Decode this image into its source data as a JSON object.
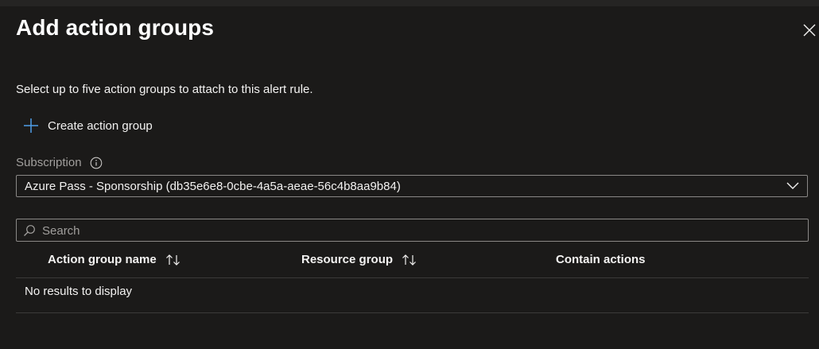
{
  "panel": {
    "title": "Add action groups",
    "description": "Select up to five action groups to attach to this alert rule."
  },
  "actions": {
    "create_label": "Create action group",
    "create_icon": "plus-icon",
    "close_icon": "close-icon"
  },
  "subscription": {
    "label": "Subscription",
    "info_icon": "info-icon",
    "selected": "Azure Pass - Sponsorship (db35e6e8-0cbe-4a5a-aeae-56c4b8aa9b84)"
  },
  "search": {
    "placeholder": "Search",
    "value": ""
  },
  "table": {
    "columns": [
      {
        "label": "Action group name",
        "sortable": true
      },
      {
        "label": "Resource group",
        "sortable": true
      },
      {
        "label": "Contain actions",
        "sortable": false
      }
    ],
    "rows": [],
    "empty_message": "No results to display"
  },
  "colors": {
    "background": "#1b1a19",
    "accent": "#4f9ee8",
    "text": "#f3f2f1",
    "muted_text": "#a19f9d",
    "border": "#8a8886"
  }
}
